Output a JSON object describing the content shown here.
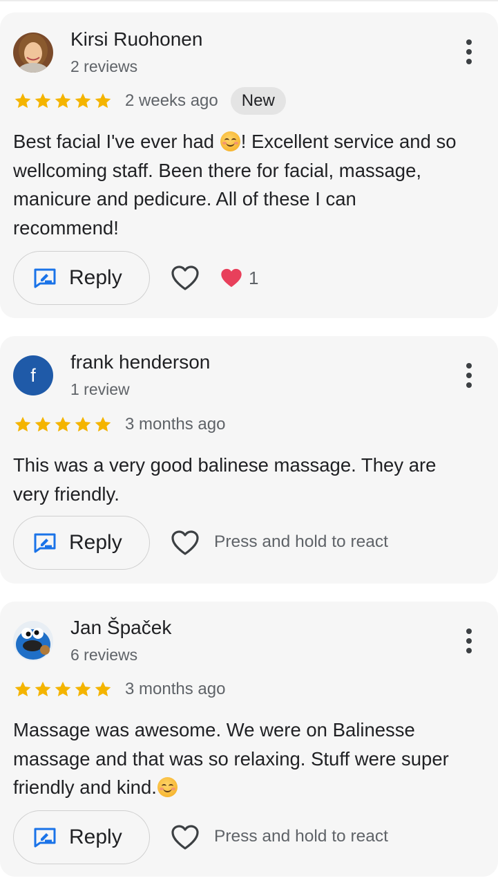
{
  "reviews": [
    {
      "name": "Kirsi Ruohonen",
      "count": "2 reviews",
      "rating": 5,
      "time": "2 weeks ago",
      "badge": "New",
      "lines": [
        "Best facial I've ever had ",
        "! Excellent service and so",
        "wellcoming staff. Been there for facial, massage,",
        "manicure and pedicure. All of these I can",
        "recommend!"
      ],
      "reply_label": "Reply",
      "reaction_count": "1"
    },
    {
      "name": "frank henderson",
      "count": "1 review",
      "avatar_letter": "f",
      "rating": 5,
      "time": "3 months ago",
      "lines": [
        "This was a very good balinese massage. They are",
        "very friendly."
      ],
      "reply_label": "Reply",
      "react_hint": "Press and hold to react"
    },
    {
      "name": "Jan Špaček",
      "count": "6 reviews",
      "rating": 5,
      "time": "3 months ago",
      "lines": [
        "Massage was awesome. We were on Balinesse",
        "massage and that was so relaxing. Stuff were super",
        "friendly and kind."
      ],
      "reply_label": "Reply",
      "react_hint": "Press and hold to react"
    }
  ],
  "colors": {
    "star": "#f4b400",
    "accent": "#1a73e8",
    "heart_filled": "#e8405b",
    "avatar_f": "#1f5aa8"
  },
  "icons": [
    "star-icon",
    "reply-icon",
    "heart-outline-icon",
    "heart-filled-icon",
    "more-vert-icon",
    "smiling-emoji-icon"
  ]
}
